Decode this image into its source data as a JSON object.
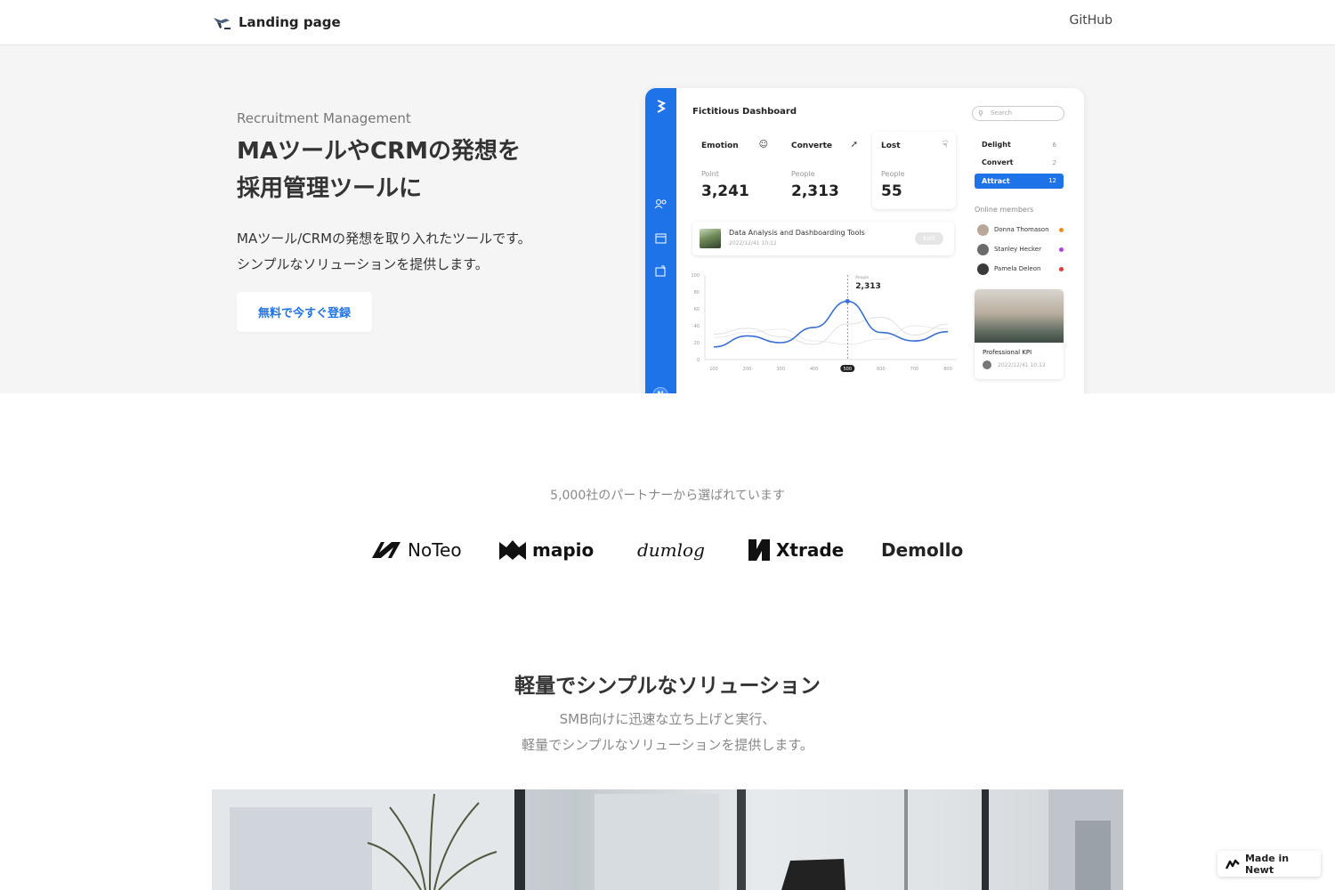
{
  "header": {
    "brand_name": "Landing page",
    "github_label": "GitHub"
  },
  "hero": {
    "subtitle": "Recruitment Management",
    "title_line1": "MAツールやCRMの発想を",
    "title_line2": "採用管理ツールに",
    "desc_line1": "MAツール/CRMの発想を取り入れたツールです。",
    "desc_line2": "シンプルなソリューションを提供します。",
    "cta_label": "無料で今すぐ登録"
  },
  "dashboard": {
    "title": "Fictitious Dashboard",
    "search_placeholder": "Search",
    "avatar_initial": "N",
    "cards": [
      {
        "label": "Emotion",
        "unit": "Point",
        "value": "3,241",
        "icon": "smile-icon",
        "bg": "#e6f6e9"
      },
      {
        "label": "Converte",
        "unit": "People",
        "value": "2,313",
        "icon": "rocket-icon",
        "bg": "#e4f1fb"
      },
      {
        "label": "Lost",
        "unit": "People",
        "value": "55",
        "icon": "thumbs-down-icon",
        "bg": "#ffffff"
      }
    ],
    "task": {
      "title": "Data Analysis and Dashboarding Tools",
      "date": "2022/12/41 10:12",
      "button": "Edit"
    },
    "categories": [
      {
        "label": "Delight",
        "count": "6"
      },
      {
        "label": "Convert",
        "count": "2"
      },
      {
        "label": "Attract",
        "count": "12",
        "active": true
      }
    ],
    "online_label": "Online members",
    "members": [
      {
        "name": "Donna Thomason",
        "status_color": "#f08a24"
      },
      {
        "name": "Stanley Hecker",
        "status_color": "#b040e0"
      },
      {
        "name": "Pamela Deleon",
        "status_color": "#e23a3a"
      }
    ],
    "kpi": {
      "title": "Professional KPI",
      "date": "2022/12/41 10:12"
    },
    "chart_data": {
      "type": "line",
      "y_ticks": [
        "100",
        "80",
        "60",
        "40",
        "20",
        "0"
      ],
      "x_ticks": [
        "100",
        "200",
        "300",
        "400",
        "500",
        "600",
        "700",
        "800"
      ],
      "highlight_x": "500",
      "tooltip_label": "People",
      "tooltip_value": "2,313",
      "ylim": [
        0,
        100
      ],
      "series": [
        {
          "values": [
            15,
            28,
            20,
            38,
            69,
            32,
            22,
            33
          ],
          "color": "#3a6fd8"
        },
        {
          "values": [
            30,
            37,
            27,
            18,
            42,
            50,
            29,
            42
          ],
          "color": "#dddddd"
        },
        {
          "values": [
            26,
            32,
            36,
            22,
            18,
            24,
            40,
            36
          ],
          "color": "#e8e8e8"
        }
      ]
    }
  },
  "partners": {
    "lead": "5,000社のパートナーから選ばれています",
    "logos": [
      "NoTeo",
      "mapio",
      "dumlog",
      "Xtrade",
      "Demollo"
    ]
  },
  "solution": {
    "title": "軽量でシンプルなソリューション",
    "desc_line1": "SMB向けに迅速な立ち上げと実行、",
    "desc_line2": "軽量でシンプルなソリューションを提供します。"
  },
  "badge": {
    "label": "Made in Newt"
  }
}
